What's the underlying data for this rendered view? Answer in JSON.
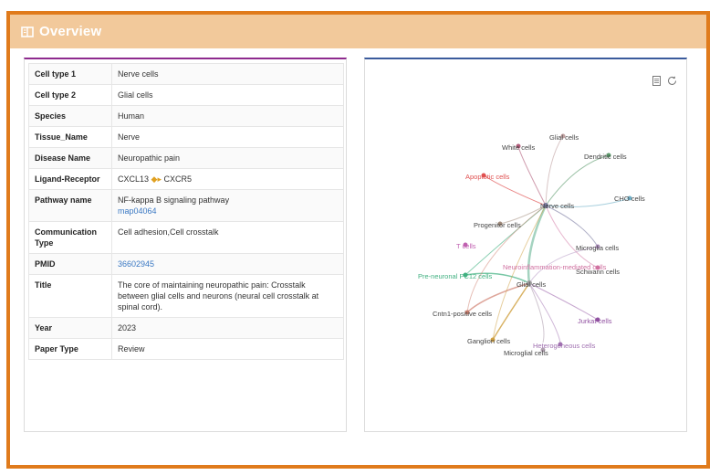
{
  "header": {
    "title": "Overview",
    "icon": "book-icon",
    "accent": "#e07b1c"
  },
  "table": {
    "rows": [
      {
        "key": "Cell type 1",
        "value": "Nerve cells"
      },
      {
        "key": "Cell type 2",
        "value": "Glial cells"
      },
      {
        "key": "Species",
        "value": "Human"
      },
      {
        "key": "Tissue_Name",
        "value": "Nerve"
      },
      {
        "key": "Disease Name",
        "value": "Neuropathic pain"
      },
      {
        "key": "Ligand-Receptor",
        "ligand": "CXCL13",
        "receptor": "CXCR5"
      },
      {
        "key": "Pathway name",
        "value": "NF-kappa B signaling pathway",
        "link": "map04064"
      },
      {
        "key": "Communication Type",
        "value": "Cell adhesion,Cell crosstalk"
      },
      {
        "key": "PMID",
        "link": "36602945"
      },
      {
        "key": "Title",
        "value": "The core of maintaining neuropathic pain: Crosstalk between glial cells and neurons (neural cell crosstalk at spinal cord)."
      },
      {
        "key": "Year",
        "value": "2023"
      },
      {
        "key": "Paper Type",
        "value": "Review"
      }
    ]
  },
  "toolbar": {
    "icons": [
      "data-view-icon",
      "refresh-icon"
    ]
  },
  "network": {
    "nodes": [
      {
        "label": "Glial cells",
        "color": "#c0a0a0"
      },
      {
        "label": "White cells",
        "color": "#b05a78"
      },
      {
        "label": "Dendritic cells",
        "color": "#5a9a6a"
      },
      {
        "label": "Apoptotic cells",
        "color": "#e05050"
      },
      {
        "label": "Nerve cells",
        "color": "#7a7aa0"
      },
      {
        "label": "CHO cells",
        "color": "#70b0c8"
      },
      {
        "label": "Progenitor cells",
        "color": "#a08a7a"
      },
      {
        "label": "T cells",
        "color": "#c060b0"
      },
      {
        "label": "Microglia cells",
        "color": "#b090c0"
      },
      {
        "label": "Neuroinflammation-mediated cells",
        "color": "#d070a0"
      },
      {
        "label": "Schwann cells",
        "color": "#9a9a9a"
      },
      {
        "label": "Pre-neuronal PC12 cells",
        "color": "#40b080"
      },
      {
        "label": "Glial cells",
        "color": "#a0a0a0"
      },
      {
        "label": "Cntn1-positive cells",
        "color": "#d08070"
      },
      {
        "label": "Jurkat cells",
        "color": "#9050a0"
      },
      {
        "label": "Ganglion cells",
        "color": "#d0a040"
      },
      {
        "label": "Heterogeneous cells",
        "color": "#a070b0"
      },
      {
        "label": "Microglial cells",
        "color": "#b0a0b0"
      }
    ]
  }
}
